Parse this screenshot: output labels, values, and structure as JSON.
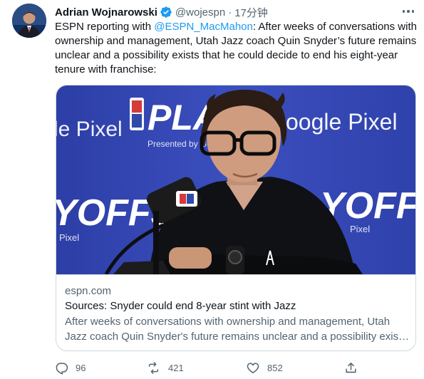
{
  "author": {
    "name": "Adrian Wojnarowski",
    "handle": "@wojespn",
    "separator": "·",
    "time": "17分钟",
    "avatar_icon": "profile-photo",
    "verified_icon": "verified-badge-icon"
  },
  "tweet": {
    "text_before": "ESPN reporting with ",
    "mention": "@ESPN_MacMahon",
    "text_after": ": After weeks of conversations with ownership and management, Utah Jazz coach Quin Snyder’s future remains unclear and a possibility exists that he could decide to end his eight-year tenure with franchise:"
  },
  "card": {
    "image_text": {
      "left_brand": "le Pixel",
      "right_brand": "oogle Pixel",
      "play_text": "PLA",
      "presented": "Presented by Google Pix",
      "playoffs_left": "YOFFS",
      "playoffs_right": "YOFFS",
      "pixel_small_left": "Pixel",
      "pixel_small_right": "Pixel"
    },
    "domain": "espn.com",
    "title": "Sources: Snyder could end 8-year stint with Jazz",
    "description": "After weeks of conversations with ownership and management, Utah Jazz coach Quin Snyder's future remains unclear and a possibility exists that he could decide to end his eight-year tenure with franchise."
  },
  "actions": {
    "reply": {
      "icon": "reply-icon",
      "count": "96"
    },
    "retweet": {
      "icon": "retweet-icon",
      "count": "421"
    },
    "like": {
      "icon": "heart-icon",
      "count": "852"
    },
    "share": {
      "icon": "share-icon"
    }
  },
  "colors": {
    "accent": "#1d9bf0",
    "text_primary": "#0f1419",
    "text_secondary": "#536471",
    "border": "#cfd9de",
    "backdrop_blue": "#3346b3"
  }
}
